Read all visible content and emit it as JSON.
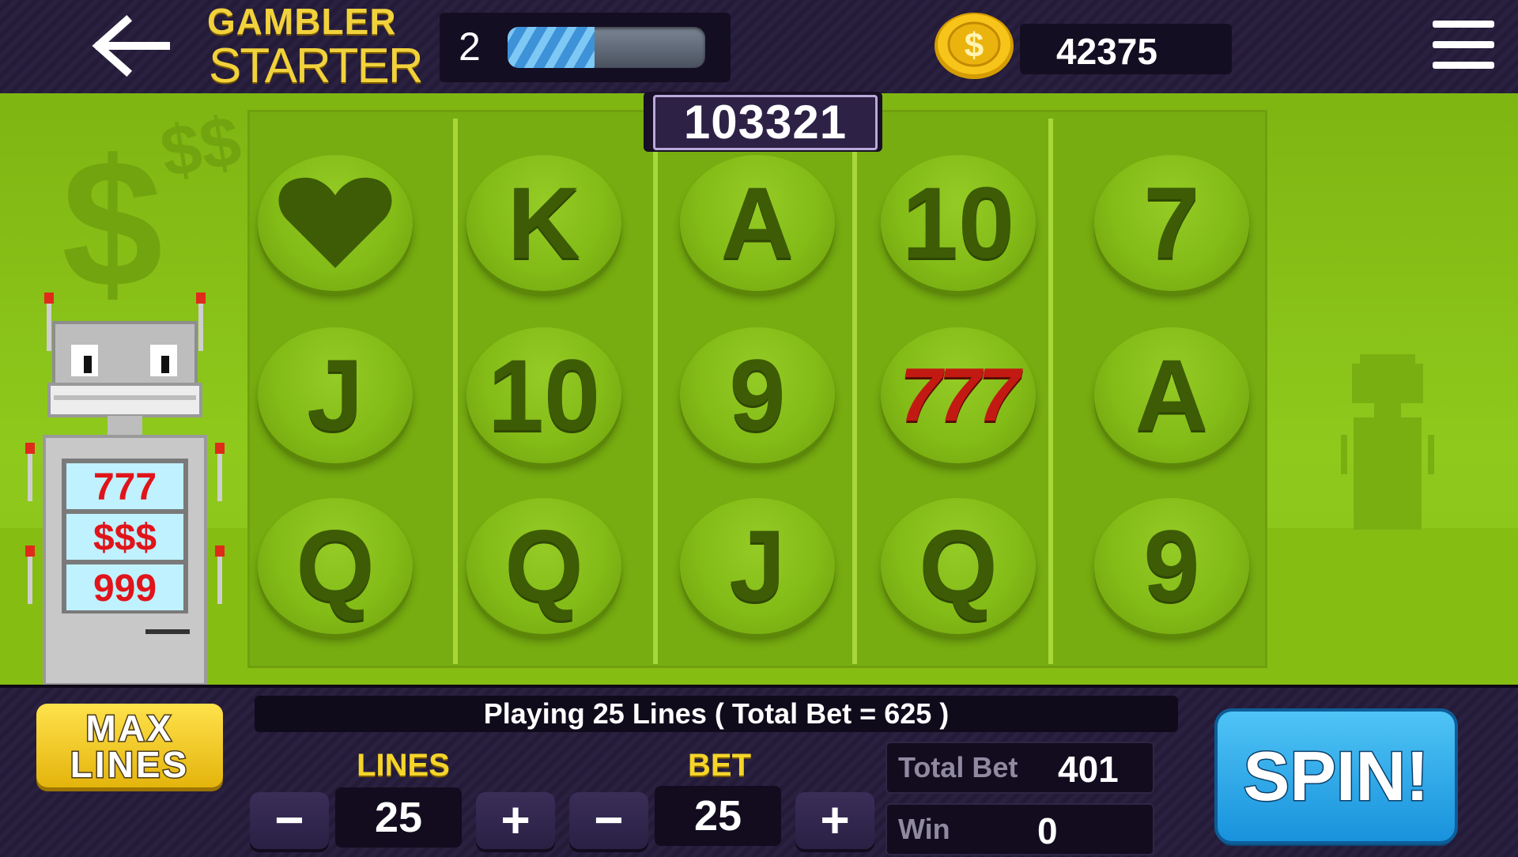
{
  "header": {
    "back_icon": "arrow-left-icon",
    "logo_line1": "GAMBLER",
    "logo_line2": "STARTER",
    "level": "2",
    "xp_progress_percent": 44,
    "coin_icon": "dollar-coin-icon",
    "coins": "42375",
    "menu_icon": "hamburger-menu-icon"
  },
  "jackpot": "103321",
  "reels": [
    [
      "♥",
      "J",
      "Q"
    ],
    [
      "K",
      "10",
      "Q"
    ],
    [
      "A",
      "9",
      "J"
    ],
    [
      "10",
      "777",
      "Q"
    ],
    [
      "7",
      "A",
      "9"
    ]
  ],
  "machine_display": [
    "777",
    "$$$",
    "999"
  ],
  "controls": {
    "max_lines_line1": "MAX",
    "max_lines_line2": "LINES",
    "status": "Playing 25 Lines ( Total Bet = 625 )",
    "lines_label": "LINES",
    "lines_value": "25",
    "bet_label": "BET",
    "bet_value": "25",
    "minus": "−",
    "plus": "+",
    "total_bet_label": "Total Bet",
    "total_bet_value": "401",
    "win_label": "Win",
    "win_value": "0",
    "spin_label": "SPIN!"
  },
  "colors": {
    "field_green": "#8fc91c",
    "symbol_dark": "#3d5c05",
    "accent_gold": "#f2d23c",
    "spin_blue": "#1892dc",
    "seven_red": "#c21a12"
  }
}
